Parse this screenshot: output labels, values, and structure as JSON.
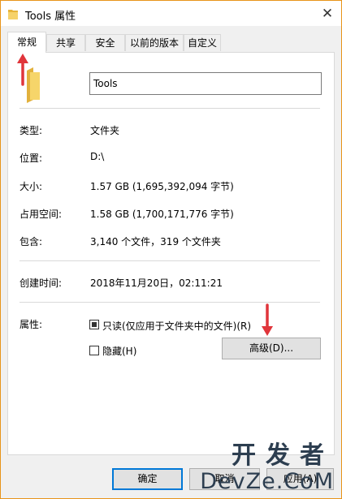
{
  "window": {
    "title": "Tools 属性",
    "close_glyph": "✕"
  },
  "tabs": [
    {
      "label": "常规",
      "active": true
    },
    {
      "label": "共享"
    },
    {
      "label": "安全"
    },
    {
      "label": "以前的版本"
    },
    {
      "label": "自定义"
    }
  ],
  "general": {
    "name_value": "Tools",
    "rows": [
      {
        "label": "类型:",
        "value": "文件夹"
      },
      {
        "label": "位置:",
        "value": "D:\\"
      },
      {
        "label": "大小:",
        "value": "1.57 GB (1,695,392,094 字节)"
      },
      {
        "label": "占用空间:",
        "value": "1.58 GB (1,700,171,776 字节)"
      },
      {
        "label": "包含:",
        "value": "3,140 个文件，319 个文件夹"
      }
    ],
    "created": {
      "label": "创建时间:",
      "value": "2018年11月20日，02:11:21"
    },
    "attributes": {
      "label": "属性:",
      "readonly_label": "只读(仅应用于文件夹中的文件)(R)",
      "hidden_label": "隐藏(H)",
      "advanced_label": "高级(D)..."
    }
  },
  "buttons": {
    "ok": "确定",
    "cancel": "取消",
    "apply": "应用(A)"
  },
  "watermark": {
    "line1": "开发者",
    "line2": "DevZe.CoM"
  },
  "colors": {
    "arrow": "#e0353b",
    "title_border": "#e8941a",
    "folder": "#f3c74e",
    "accent": "#0078d7"
  }
}
